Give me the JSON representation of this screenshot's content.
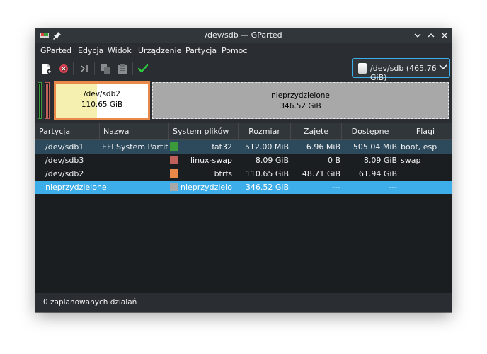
{
  "window": {
    "title": "/dev/sdb — GParted"
  },
  "menu": [
    "GParted",
    "Edycja",
    "Widok",
    "Urządzenie",
    "Partycja",
    "Pomoc"
  ],
  "toolbar": {
    "icons": [
      "new-partition-icon",
      "delete-icon",
      "resize-move-icon",
      "copy-icon",
      "paste-icon",
      "apply-icon"
    ]
  },
  "device_selector": {
    "value": "/dev/sdb (465.76 GiB)"
  },
  "partition_map": {
    "sdb2": {
      "name": "/dev/sdb2",
      "size": "110.65 GiB"
    },
    "unallocated": {
      "name": "nieprzydzielone",
      "size": "346.52 GiB"
    }
  },
  "table": {
    "headers": [
      "Partycja",
      "Nazwa",
      "System plików",
      "Rozmiar",
      "Zajęte",
      "Dostępne",
      "Flagi"
    ],
    "rows": [
      {
        "partition": "/dev/sdb1",
        "name": "EFI System Partition",
        "fs": "fat32",
        "fs_color": "#3b9a3b",
        "size": "512.00 MiB",
        "used": "6.96 MiB",
        "free": "505.04 MiB",
        "flags": "boot, esp"
      },
      {
        "partition": "/dev/sdb3",
        "name": "",
        "fs": "linux-swap",
        "fs_color": "#c0605a",
        "size": "8.09 GiB",
        "used": "0 B",
        "free": "8.09 GiB",
        "flags": "swap"
      },
      {
        "partition": "/dev/sdb2",
        "name": "",
        "fs": "btrfs",
        "fs_color": "#e8894a",
        "size": "110.65 GiB",
        "used": "48.71 GiB",
        "free": "61.94 GiB",
        "flags": ""
      },
      {
        "partition": "nieprzydzielone",
        "name": "",
        "fs": "nieprzydzielone",
        "fs_color": "#a8a8a8",
        "size": "346.52 GiB",
        "used": "---",
        "free": "---",
        "flags": ""
      }
    ]
  },
  "status": {
    "text": "0 zaplanowanych działań"
  },
  "colors": {
    "selection": "#3daee9",
    "selection_dim": "#2d4a5c",
    "fat32": "#3b9a3b",
    "swap": "#c0605a",
    "btrfs": "#e8894a",
    "unallocated": "#a8a8a8"
  }
}
